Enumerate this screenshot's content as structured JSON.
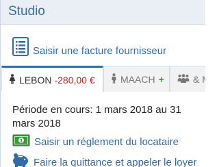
{
  "panel": {
    "title": "Studio"
  },
  "actions": {
    "invoice_label": "Saisir une facture fournisseur",
    "payment_label": "Saisir un réglement du locataire",
    "receipt_label": "Faire la quittance et appeler le loyer"
  },
  "tabs": [
    {
      "name": "LEBON",
      "amount": "-280,00 €",
      "icon": "female-person-icon",
      "active": true
    },
    {
      "name": "MAACH",
      "badge": "+",
      "icon": "person-icon",
      "active": false
    },
    {
      "name": "& M",
      "icon": "group-icon",
      "active": false
    }
  ],
  "period": {
    "text": "Période en cours: 1 mars 2018 au 31 mars 2018"
  },
  "colors": {
    "accent": "#2f6eaa",
    "negative": "#cc1f1a",
    "positive": "#3c9a3c",
    "header_bg": "#e9eff5"
  }
}
